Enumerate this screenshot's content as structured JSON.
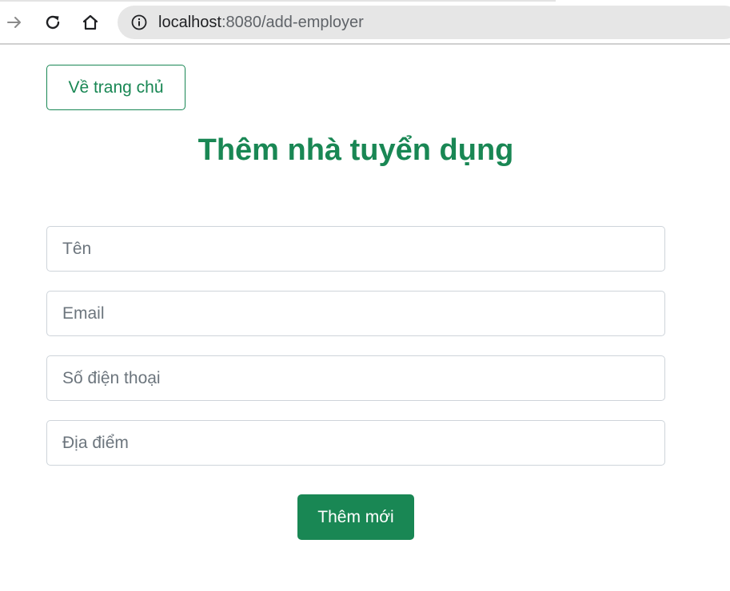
{
  "browser": {
    "url_host": "localhost",
    "url_rest": ":8080/add-employer",
    "icons": {
      "forward": "forward-arrow-icon",
      "reload": "reload-icon",
      "home": "home-icon",
      "info": "info-icon"
    }
  },
  "page": {
    "home_link_label": "Về trang chủ",
    "title": "Thêm nhà tuyển dụng",
    "form": {
      "name": {
        "placeholder": "Tên",
        "value": ""
      },
      "email": {
        "placeholder": "Email",
        "value": ""
      },
      "phone": {
        "placeholder": "Số điện thoại",
        "value": ""
      },
      "location": {
        "placeholder": "Địa điểm",
        "value": ""
      }
    },
    "submit_label": "Thêm mới"
  },
  "colors": {
    "accent": "#198754",
    "input_border": "#ced4da",
    "placeholder": "#6c757d",
    "omnibox_bg": "#e6e6e6"
  }
}
